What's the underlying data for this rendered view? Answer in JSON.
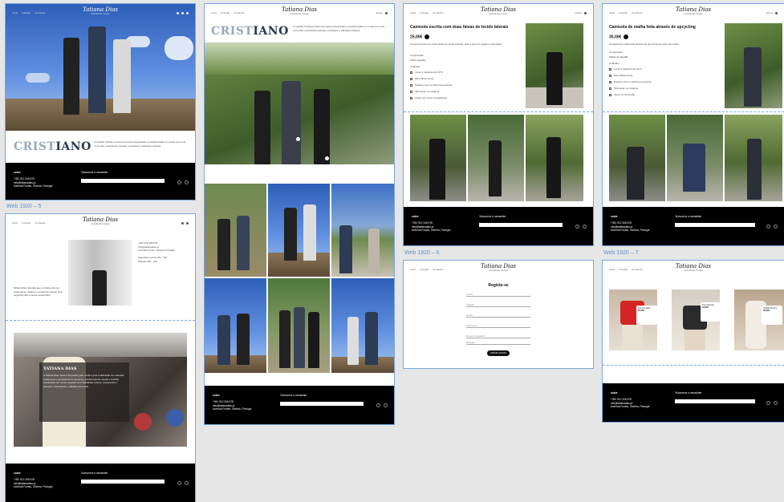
{
  "brand": {
    "name": "Tatiana Dias",
    "tagline": "sustainable design"
  },
  "nav": {
    "links": [
      "Início",
      "Coleção",
      "Contactos"
    ],
    "login": "Entrar"
  },
  "frame_labels": {
    "web5": "Web 1920 – 5",
    "web6": "Web 1920 – 6",
    "web7": "Web 1920 – 7"
  },
  "hero": {
    "title_a": "CRIST",
    "title_b": "IANO",
    "description": "A coleção Cristiano nasce de peças recuperadas e transformadas em roupa com uma nova vida, explorando texturas, contrastes e silhuetas urbanas."
  },
  "footer": {
    "heading": "sobre",
    "phone": "+351 912 345 678",
    "email": "info@tatianadias.pt",
    "address": "Avenida Fontes, Oliveira, Portugal",
    "newsletter": "Subscreve a newsletter"
  },
  "about": {
    "contact_lines": [
      "+351 912 345 678",
      "info@tatianadias.pt",
      "Avenida Fontes, Oliveira, Portugal"
    ],
    "hours_lines": [
      "Segunda a sexta 10h - 19h",
      "Sábado 10h - 13h"
    ],
    "quote": "Tatiana Dias acredita que a moda pode ser sustentável, criativa e consciente, dando uma segunda vida a peças esquecidas.",
    "name": "TATIANA DIAS",
    "bio": "A Tatiana Dias nasceu da paixão pela moda e pela reutilização de materiais. Cada peça é pensada de forma única, transformando roupas e tecidos esquecidos em novas criações com identidade própria, respeitando o planeta e valorizando o trabalho artesanal."
  },
  "product1": {
    "title": "Camisola escrita com duas faixas de tecido laterais",
    "price": "25,00€",
    "desc": "Camisola preta com duas faixas de tecido laterais, feita a partir de peças recuperadas.",
    "composition_label": "Composição",
    "composition": "100% algodão",
    "care_label": "Cuidados",
    "care": [
      "Lavar à máquina até 30°C",
      "Não utilizar lixívia",
      "Passar a ferro a baixa temperatura",
      "Não secar na máquina",
      "Lavar com cores semelhantes"
    ]
  },
  "product2": {
    "title": "Camisola de malha feita através de upcycling",
    "price": "30,00€",
    "desc": "Camisola de malha feita através de upcycling de restos de malha.",
    "composition_label": "Composição",
    "composition": "Malha de algodão",
    "care_label": "Cuidados",
    "care": [
      "Lavar à máquina até 30°C",
      "Não utilizar lixívia",
      "Passar a ferro a baixa temperatura",
      "Não secar na máquina",
      "Secar na horizontal"
    ]
  },
  "register": {
    "title": "Registe-se",
    "fields": [
      "Nome",
      "Apelido",
      "Email",
      "Password",
      "Repetir password",
      "Morada"
    ],
    "button": "CRIAR CONTA"
  },
  "shop": {
    "items": [
      {
        "name": "Top vermelho",
        "price": "20,00€"
      },
      {
        "name": "Top cinzento",
        "price": "18,00€"
      },
      {
        "name": "Vestido branco",
        "price": "35,00€"
      }
    ]
  }
}
